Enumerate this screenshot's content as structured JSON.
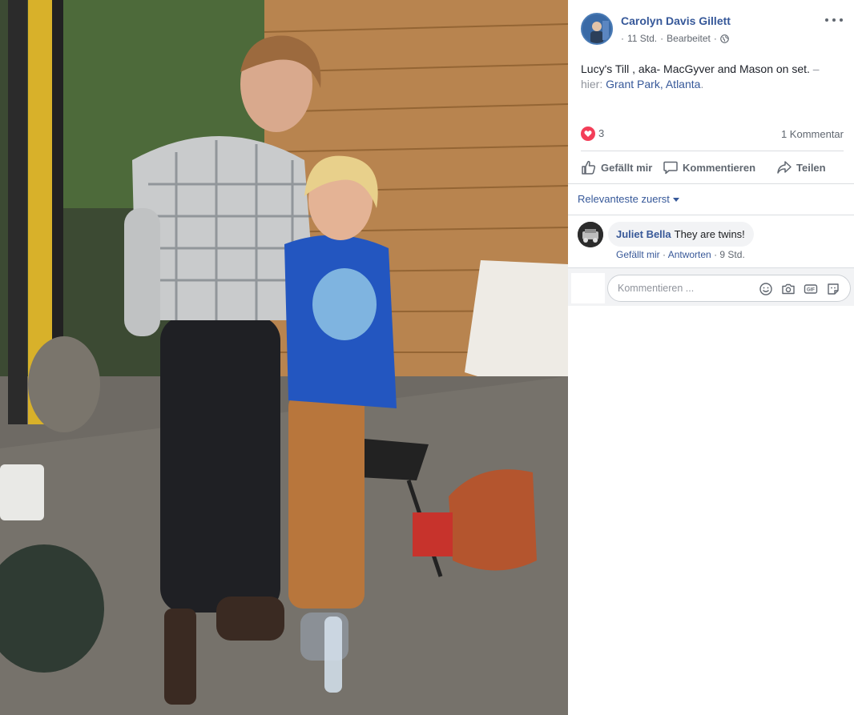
{
  "post": {
    "author": "Carolyn Davis Gillett",
    "time": "11 Std.",
    "dot": "·",
    "edited": "Bearbeitet",
    "caption_main": "Lucy's Till , aka- MacGyver and Mason on set.",
    "caption_dash": " –",
    "caption_prefix": "hier:",
    "location_part1": "Grant Park",
    "location_sep": ", ",
    "location_part2": "Atlanta",
    "location_end": "."
  },
  "reactions": {
    "count": "3",
    "comments_label": "1 Kommentar"
  },
  "actions": {
    "like": "Gefällt mir",
    "comment": "Kommentieren",
    "share": "Teilen"
  },
  "sort": {
    "label": "Relevanteste zuerst"
  },
  "comment": {
    "name": "Juliet Bella",
    "text": "They are twins!",
    "like": "Gefällt mir",
    "dot": "·",
    "reply": "Antworten",
    "time": "9 Std."
  },
  "composer": {
    "placeholder": "Kommentieren ..."
  },
  "colors": {
    "link": "#365899",
    "heart": "#f33e58",
    "muted": "#606770"
  },
  "icons": [
    "globe-icon",
    "more-options-icon",
    "love-reaction-icon",
    "like-icon",
    "comment-icon",
    "share-icon",
    "emoji-icon",
    "camera-icon",
    "gif-icon",
    "sticker-icon"
  ]
}
